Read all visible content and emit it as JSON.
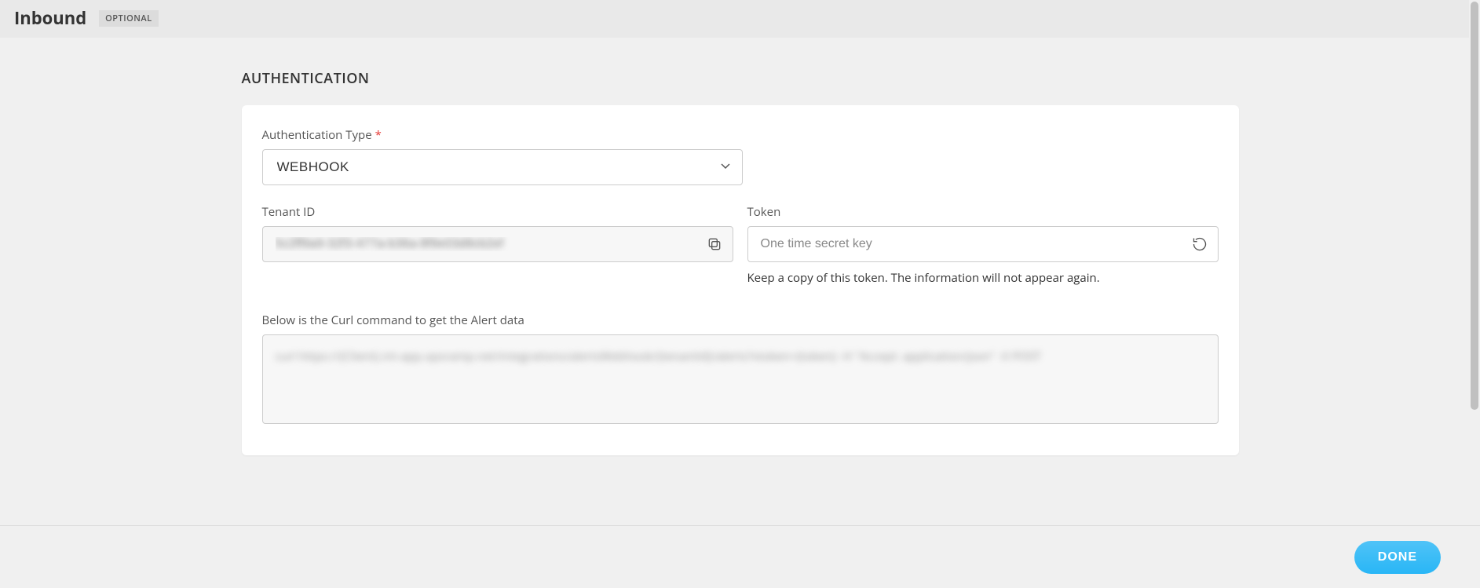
{
  "header": {
    "title": "Inbound",
    "badge": "OPTIONAL"
  },
  "section": {
    "title": "AUTHENTICATION"
  },
  "authType": {
    "label": "Authentication Type",
    "value": "WEBHOOK"
  },
  "tenantId": {
    "label": "Tenant ID",
    "value": "5c2ff9a9-32f3-477a-b36a-8f9e03d8cb2ef"
  },
  "token": {
    "label": "Token",
    "placeholder": "One time secret key",
    "helper": "Keep a copy of this token. The information will not appear again."
  },
  "curl": {
    "label": "Below is the Curl command to get the Alert data",
    "value": "curl https://{Client}.int-app.opsramp.net/integrations/alertsWebhook/{tenantId}/alerts?vtoken={token} -H \"Accept: application/json\" -X POST"
  },
  "footer": {
    "done": "DONE"
  }
}
